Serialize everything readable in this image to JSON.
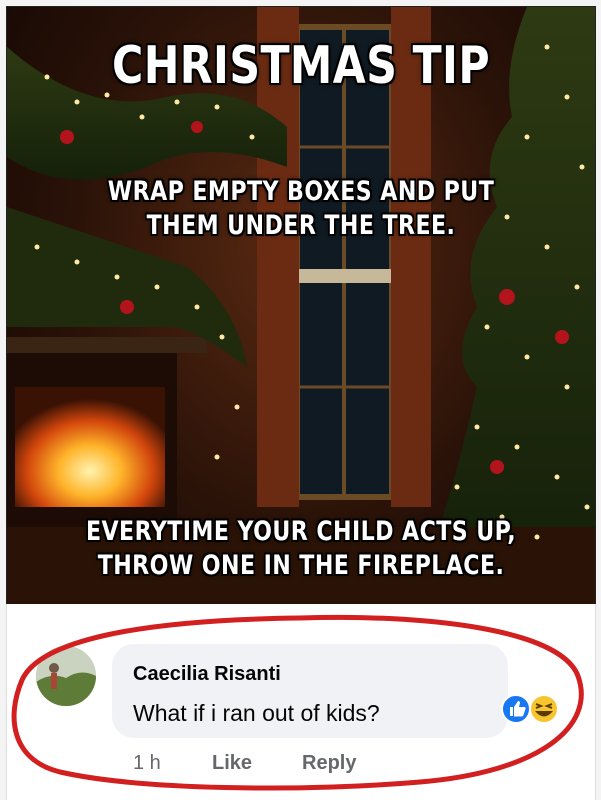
{
  "meme": {
    "title": "CHRISTMAS TIP",
    "top_text": "WRAP EMPTY BOXES AND PUT\nTHEM UNDER THE TREE.",
    "bottom_text": "EVERYTIME YOUR CHILD ACTS UP,\nTHROW ONE IN THE FIREPLACE."
  },
  "comment": {
    "author": "Caecilia Risanti",
    "text": "What if i ran out of kids?",
    "time": "1 h",
    "like_label": "Like",
    "reply_label": "Reply",
    "reactions": [
      "like-icon",
      "laughing-emoji-icon"
    ]
  },
  "colors": {
    "annotation_circle": "#d21f1f",
    "like_blue": "#1877f2",
    "emoji_yellow": "#f7c530"
  }
}
